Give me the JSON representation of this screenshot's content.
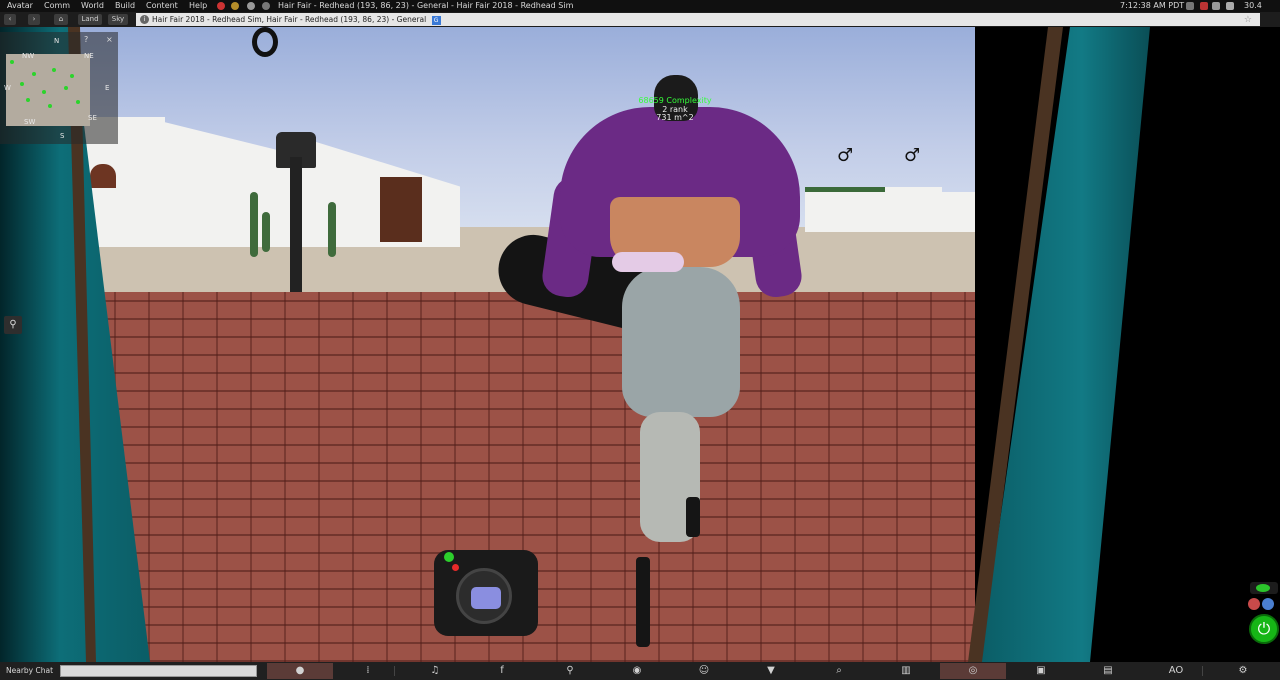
{
  "menubar": {
    "menus": [
      "Avatar",
      "Comm",
      "World",
      "Build",
      "Content",
      "Help"
    ],
    "window_title": "Hair Fair - Redhead (193, 86, 23) - General - Hair Fair 2018 - Redhead Sim",
    "clock": "7:12:38 AM PDT",
    "fps": "30.4"
  },
  "locbar": {
    "land_label": "Land",
    "sky_label": "Sky",
    "location": "Hair Fair 2018 - Redhead Sim, Hair Fair - Redhead (193, 86, 23) - General",
    "maturity_badge": "G"
  },
  "minimap": {
    "compass": {
      "n": "N",
      "ne": "NE",
      "nw": "NW",
      "e": "E",
      "w": "W",
      "sw": "SW",
      "se": "SE",
      "s": "S"
    }
  },
  "nametag": {
    "complexity": "68659 Complexity",
    "rank": "2 rank",
    "area": "731 m^2"
  },
  "toolbar": {
    "nearby_chat_label": "Nearby Chat",
    "chat_placeholder": "",
    "ao_label": "AO"
  },
  "colors": {
    "accent_green": "#2bd42b",
    "toolbar_bg": "#202020",
    "location_field_bg": "#e6e6e6",
    "active_button": "#5b3b37"
  }
}
